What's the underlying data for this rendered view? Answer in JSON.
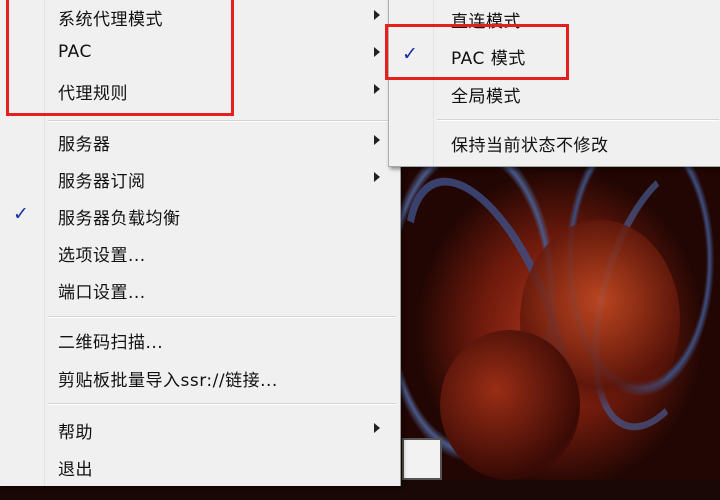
{
  "main_menu": {
    "items": [
      {
        "label": "系统代理模式",
        "has_submenu": true,
        "checked": false
      },
      {
        "label": "PAC",
        "has_submenu": true,
        "checked": false
      },
      {
        "label": "代理规则",
        "has_submenu": true,
        "checked": false
      },
      {
        "label": "服务器",
        "has_submenu": true,
        "checked": false
      },
      {
        "label": "服务器订阅",
        "has_submenu": true,
        "checked": false
      },
      {
        "label": "服务器负载均衡",
        "has_submenu": false,
        "checked": true
      },
      {
        "label": "选项设置...",
        "has_submenu": false,
        "checked": false
      },
      {
        "label": "端口设置...",
        "has_submenu": false,
        "checked": false
      },
      {
        "label": "二维码扫描...",
        "has_submenu": false,
        "checked": false
      },
      {
        "label": "剪贴板批量导入ssr://链接...",
        "has_submenu": false,
        "checked": false
      },
      {
        "label": "帮助",
        "has_submenu": true,
        "checked": false
      },
      {
        "label": "退出",
        "has_submenu": false,
        "checked": false
      }
    ]
  },
  "sub_menu": {
    "items": [
      {
        "label": "直连模式",
        "checked": false
      },
      {
        "label": "PAC 模式",
        "checked": true
      },
      {
        "label": "全局模式",
        "checked": false
      },
      {
        "label": "保持当前状态不修改",
        "checked": false
      }
    ]
  },
  "check_glyph": "✓",
  "colors": {
    "menu_bg": "#f0f0f0",
    "check": "#1b2fa0",
    "highlight_box": "#e3201e"
  }
}
